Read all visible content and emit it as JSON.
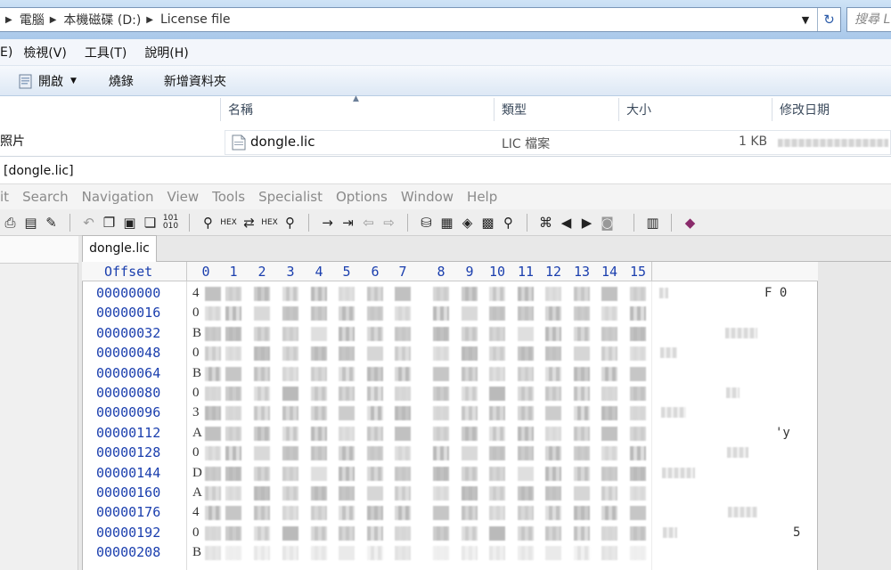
{
  "explorer": {
    "breadcrumb": [
      "電腦",
      "本機磁碟 (D:)",
      "License file"
    ],
    "search_placeholder": "搜尋 L",
    "menu": [
      "E)",
      "檢視(V)",
      "工具(T)",
      "說明(H)"
    ],
    "commands": [
      {
        "label": "開啟",
        "icon": "open-icon",
        "has_dropdown": true
      },
      {
        "label": "燒錄"
      },
      {
        "label": "新增資料夾"
      }
    ],
    "nav_item": "照片",
    "columns": [
      "名稱",
      "類型",
      "大小",
      "修改日期"
    ],
    "file": {
      "name": "dongle.lic",
      "type": "LIC 檔案",
      "size": "1 KB"
    }
  },
  "hex_editor": {
    "window_title": "[dongle.lic]",
    "menu": [
      "it",
      "Search",
      "Navigation",
      "View",
      "Tools",
      "Specialist",
      "Options",
      "Window",
      "Help"
    ],
    "tab": "dongle.lic",
    "offset_header": "Offset",
    "column_headers": [
      "0",
      "1",
      "2",
      "3",
      "4",
      "5",
      "6",
      "7",
      "8",
      "9",
      "10",
      "11",
      "12",
      "13",
      "14",
      "15"
    ],
    "offsets": [
      "00000000",
      "00000016",
      "00000032",
      "00000048",
      "00000064",
      "00000080",
      "00000096",
      "00000112",
      "00000128",
      "00000144",
      "00000160",
      "00000176",
      "00000192",
      "00000208"
    ],
    "row_first_chars": [
      "4",
      "0",
      "B",
      "0",
      "B",
      "0",
      "3",
      "A",
      "0",
      "D",
      "A",
      "4",
      "0",
      "B"
    ],
    "ascii_visible": [
      {
        "row": 0,
        "text": "F 0"
      },
      {
        "row": 7,
        "text": "'y"
      },
      {
        "row": 12,
        "text": "5"
      }
    ]
  }
}
